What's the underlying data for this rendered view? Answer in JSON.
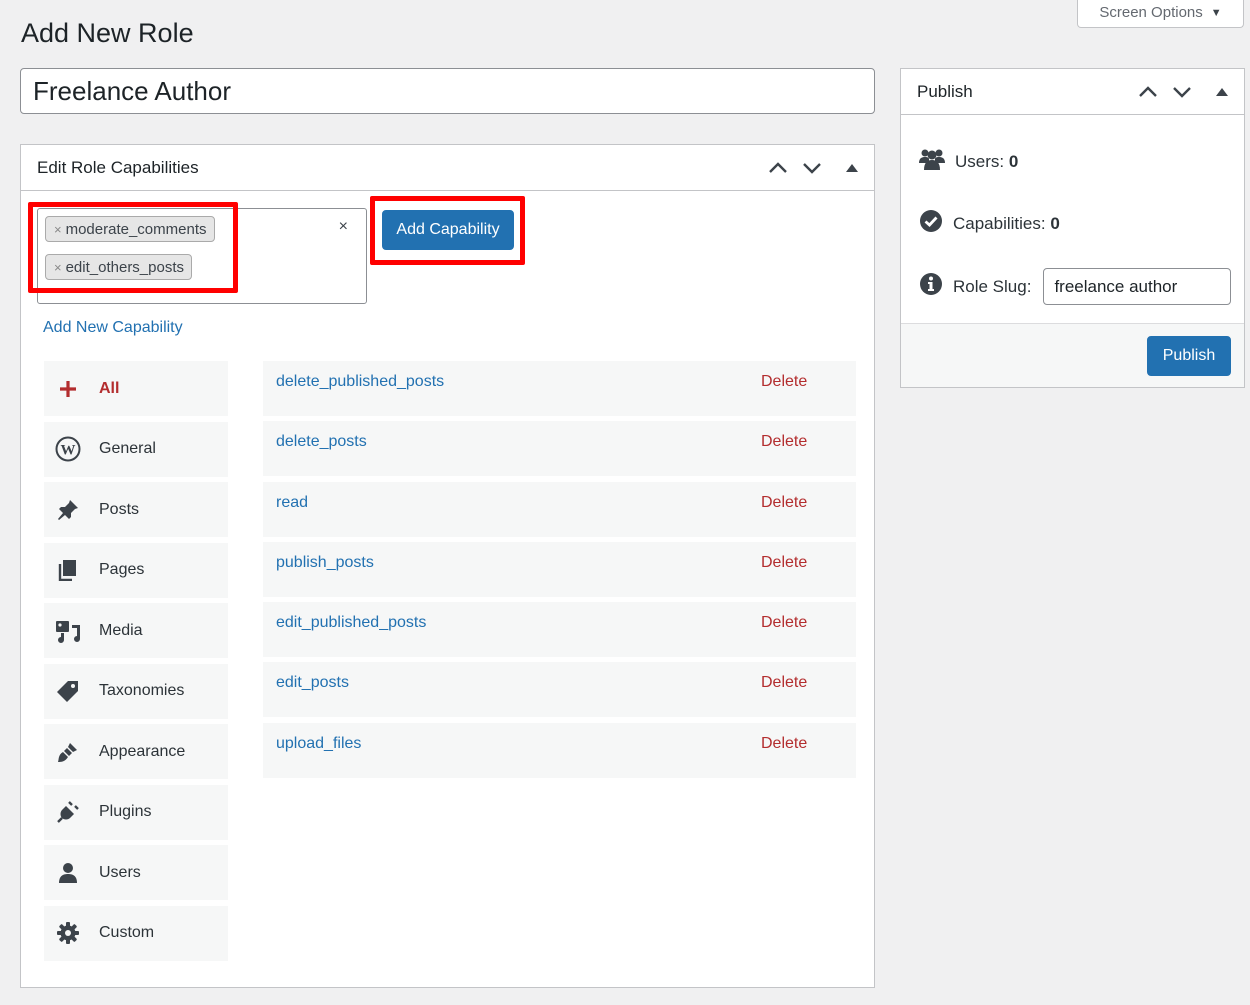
{
  "screen_options": {
    "label": "Screen Options"
  },
  "page": {
    "title": "Add New Role"
  },
  "role_name": {
    "value": "Freelance Author"
  },
  "capabilities_box": {
    "title": "Edit Role Capabilities",
    "selected_tags": [
      "moderate_comments",
      "edit_others_posts"
    ],
    "add_button": "Add Capability",
    "add_new_link": "Add New Capability",
    "categories": [
      {
        "label": "All",
        "icon": "plus-icon",
        "active": true
      },
      {
        "label": "General",
        "icon": "wordpress-icon"
      },
      {
        "label": "Posts",
        "icon": "pin-icon"
      },
      {
        "label": "Pages",
        "icon": "pages-icon"
      },
      {
        "label": "Media",
        "icon": "media-icon"
      },
      {
        "label": "Taxonomies",
        "icon": "tag-icon"
      },
      {
        "label": "Appearance",
        "icon": "brush-icon"
      },
      {
        "label": "Plugins",
        "icon": "plugin-icon"
      },
      {
        "label": "Users",
        "icon": "user-icon"
      },
      {
        "label": "Custom",
        "icon": "gear-icon"
      }
    ],
    "capabilities": [
      {
        "name": "delete_published_posts",
        "action": "Delete"
      },
      {
        "name": "delete_posts",
        "action": "Delete"
      },
      {
        "name": "read",
        "action": "Delete"
      },
      {
        "name": "publish_posts",
        "action": "Delete"
      },
      {
        "name": "edit_published_posts",
        "action": "Delete"
      },
      {
        "name": "edit_posts",
        "action": "Delete"
      },
      {
        "name": "upload_files",
        "action": "Delete"
      }
    ]
  },
  "publish_box": {
    "title": "Publish",
    "users_label": "Users:",
    "users_count": "0",
    "capabilities_label": "Capabilities:",
    "capabilities_count": "0",
    "slug_label": "Role Slug:",
    "slug_value": "freelance author",
    "publish_button": "Publish"
  },
  "colors": {
    "accent": "#2271b1",
    "delete": "#b32d2e",
    "highlight": "#ff0000",
    "background": "#f0f0f1"
  }
}
